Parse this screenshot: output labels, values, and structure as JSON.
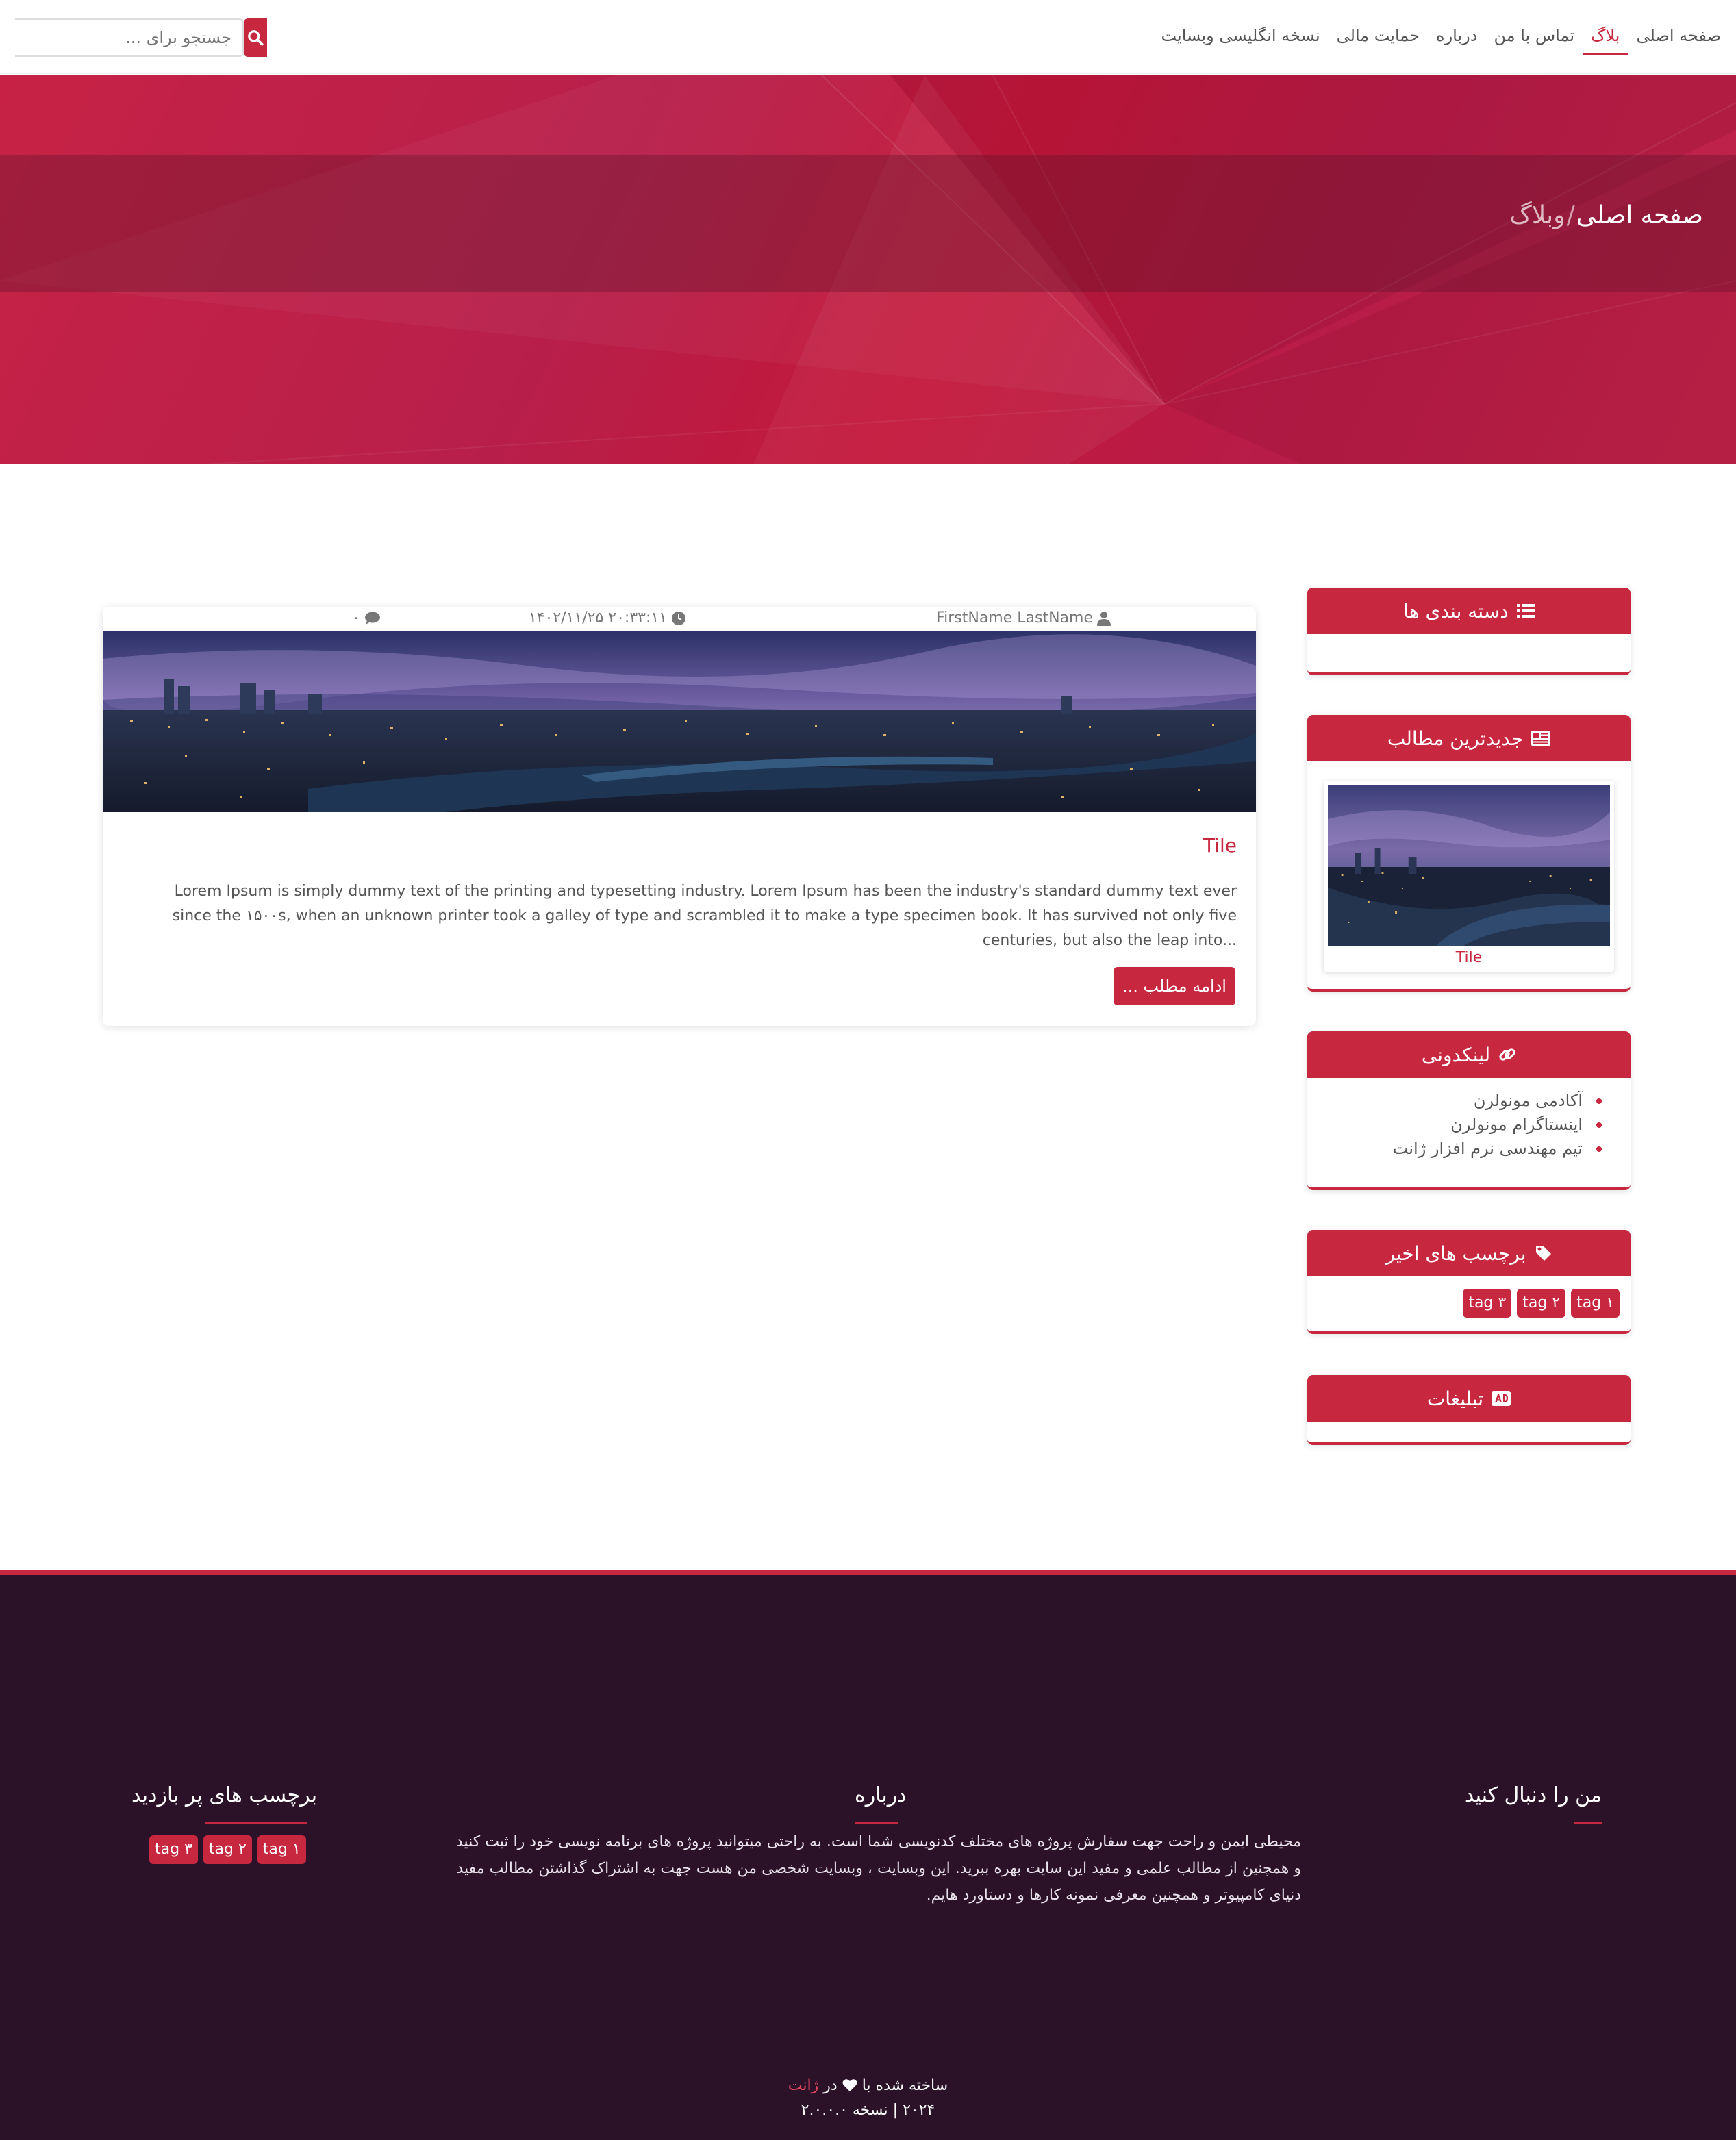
{
  "nav": {
    "items": [
      {
        "label": "صفحه اصلی",
        "active": false
      },
      {
        "label": "بلاگ",
        "active": true
      },
      {
        "label": "تماس با من",
        "active": false
      },
      {
        "label": "درباره",
        "active": false
      },
      {
        "label": "حمایت مالی",
        "active": false
      },
      {
        "label": "نسخه انگلیسی وبسایت",
        "active": false
      }
    ],
    "search_placeholder": "جستجو برای ..."
  },
  "hero": {
    "breadcrumb_home": "صفحه اصلی",
    "breadcrumb_sep": "/",
    "breadcrumb_current": "وبلاگ"
  },
  "post": {
    "author": "FirstName LastName",
    "date": "۱۴۰۲/۱۱/۲۵ ۲۰:۳۳:۱۱",
    "comments": "۰",
    "title": "Tile",
    "excerpt": "Lorem Ipsum is simply dummy text of the printing and typesetting industry. Lorem Ipsum has been the industry's standard dummy text ever since the ۱۵۰۰s, when an unknown printer took a galley of type and scrambled it to make a type specimen book. It has survived not only five centuries, but also the leap into...",
    "read_more": "ادامه مطلب ..."
  },
  "sidebar": {
    "categories_title": "دسته بندی ها",
    "latest_title": "جدیدترین مطالب",
    "latest_post_title": "Tile",
    "links_title": "لینکدونی",
    "links": [
      "آکادمی مونولرن",
      "اینستاگرام مونولرن",
      "تیم مهندسی نرم افزار ژانت"
    ],
    "tags_title": "برچسب های اخیر",
    "tags": [
      "tag ۱",
      "tag ۲",
      "tag ۳"
    ],
    "ads_title": "تبلیغات"
  },
  "footer": {
    "follow_title": "من را دنبال کنید",
    "about_title": "درباره",
    "about_text": "محیطی ایمن و راحت جهت سفارش پروژه های مختلف کدنویسی شما است. به راحتی میتوانید پروژه های برنامه نویسی خود را ثبت کنید و همچنین از مطالب علمی و مفید این سایت بهره ببرید. این وبسایت ، وبسایت شخصی من هست جهت به اشتراک گذاشتن مطالب مفید دنیای کامپیوتر و همچنین معرفی نمونه کارها و دستاورد هایم.",
    "popular_tags_title": "برچسب های پر بازدید",
    "popular_tags": [
      "tag ۱",
      "tag ۲",
      "tag ۳"
    ],
    "credit_prefix": "ساخته شده با",
    "credit_in": "در",
    "credit_brand": "ژانت",
    "version_line": "۲۰۲۴ | نسخه ۲.۰.۰.۰"
  },
  "colors": {
    "accent": "#c8283f",
    "footer_bg": "#2b1229",
    "hero": "#c0213f"
  },
  "icons": [
    "search-icon",
    "user-icon",
    "clock-icon",
    "comment-icon",
    "list-icon",
    "newspaper-icon",
    "link-icon",
    "tag-icon",
    "ad-icon",
    "heart-icon"
  ]
}
